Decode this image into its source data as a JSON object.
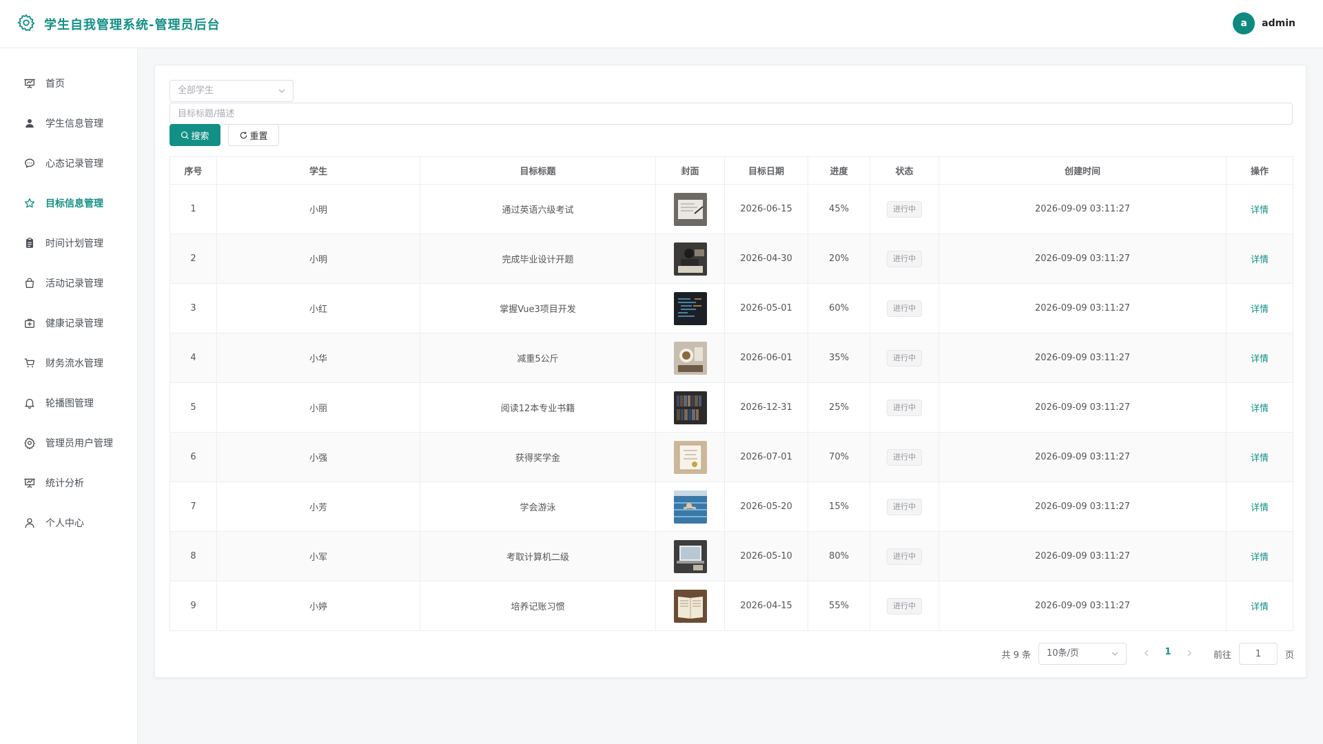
{
  "app": {
    "title": "学生自我管理系统-管理员后台",
    "accent": "#139086"
  },
  "user": {
    "avatar_letter": "a",
    "name": "admin"
  },
  "sidebar": {
    "items": [
      {
        "label": "首页",
        "icon": "presentation-icon",
        "active": false
      },
      {
        "label": "学生信息管理",
        "icon": "user-icon",
        "active": false
      },
      {
        "label": "心态记录管理",
        "icon": "chat-bubble-icon",
        "active": false
      },
      {
        "label": "目标信息管理",
        "icon": "star-icon",
        "active": true
      },
      {
        "label": "时间计划管理",
        "icon": "clipboard-icon",
        "active": false
      },
      {
        "label": "活动记录管理",
        "icon": "shopping-bag-icon",
        "active": false
      },
      {
        "label": "健康记录管理",
        "icon": "first-aid-kit-icon",
        "active": false
      },
      {
        "label": "财务流水管理",
        "icon": "cart-icon",
        "active": false
      },
      {
        "label": "轮播图管理",
        "icon": "bell-icon",
        "active": false
      },
      {
        "label": "管理员用户管理",
        "icon": "gear-icon",
        "active": false
      },
      {
        "label": "统计分析",
        "icon": "presentation-icon",
        "active": false
      },
      {
        "label": "个人中心",
        "icon": "user-outline-icon",
        "active": false
      }
    ]
  },
  "filters": {
    "student_select": "全部学生",
    "keyword_placeholder": "目标标题/描述",
    "keyword_value": "",
    "search_label": "搜索",
    "reset_label": "重置"
  },
  "table": {
    "columns": [
      "序号",
      "学生",
      "目标标题",
      "封面",
      "目标日期",
      "进度",
      "状态",
      "创建时间",
      "操作"
    ],
    "rows": [
      {
        "no": "1",
        "student": "小明",
        "title": "通过英语六级考试",
        "cover": "cover-study-notes",
        "date": "2026-06-15",
        "progress": "45%",
        "status": "进行中",
        "created": "2026-09-09 03:11:27",
        "action": "详情"
      },
      {
        "no": "2",
        "student": "小明",
        "title": "完成毕业设计开题",
        "cover": "cover-student-desk",
        "date": "2026-04-30",
        "progress": "20%",
        "status": "进行中",
        "created": "2026-09-09 03:11:27",
        "action": "详情"
      },
      {
        "no": "3",
        "student": "小红",
        "title": "掌握Vue3项目开发",
        "cover": "cover-code-screen",
        "date": "2026-05-01",
        "progress": "60%",
        "status": "进行中",
        "created": "2026-09-09 03:11:27",
        "action": "详情"
      },
      {
        "no": "4",
        "student": "小华",
        "title": "减重5公斤",
        "cover": "cover-healthy-meal",
        "date": "2026-06-01",
        "progress": "35%",
        "status": "进行中",
        "created": "2026-09-09 03:11:27",
        "action": "详情"
      },
      {
        "no": "5",
        "student": "小丽",
        "title": "阅读12本专业书籍",
        "cover": "cover-bookshelf",
        "date": "2026-12-31",
        "progress": "25%",
        "status": "进行中",
        "created": "2026-09-09 03:11:27",
        "action": "详情"
      },
      {
        "no": "6",
        "student": "小强",
        "title": "获得奖学金",
        "cover": "cover-certificate",
        "date": "2026-07-01",
        "progress": "70%",
        "status": "进行中",
        "created": "2026-09-09 03:11:27",
        "action": "详情"
      },
      {
        "no": "7",
        "student": "小芳",
        "title": "学会游泳",
        "cover": "cover-swimming",
        "date": "2026-05-20",
        "progress": "15%",
        "status": "进行中",
        "created": "2026-09-09 03:11:27",
        "action": "详情"
      },
      {
        "no": "8",
        "student": "小军",
        "title": "考取计算机二级",
        "cover": "cover-laptop",
        "date": "2026-05-10",
        "progress": "80%",
        "status": "进行中",
        "created": "2026-09-09 03:11:27",
        "action": "详情"
      },
      {
        "no": "9",
        "student": "小婷",
        "title": "培养记账习惯",
        "cover": "cover-ledger-book",
        "date": "2026-04-15",
        "progress": "55%",
        "status": "进行中",
        "created": "2026-09-09 03:11:27",
        "action": "详情"
      }
    ]
  },
  "pagination": {
    "total_text": "共 9 条",
    "page_size": "10条/页",
    "current_page": "1",
    "goto_label": "前往",
    "goto_value": "1",
    "page_unit": "页"
  }
}
